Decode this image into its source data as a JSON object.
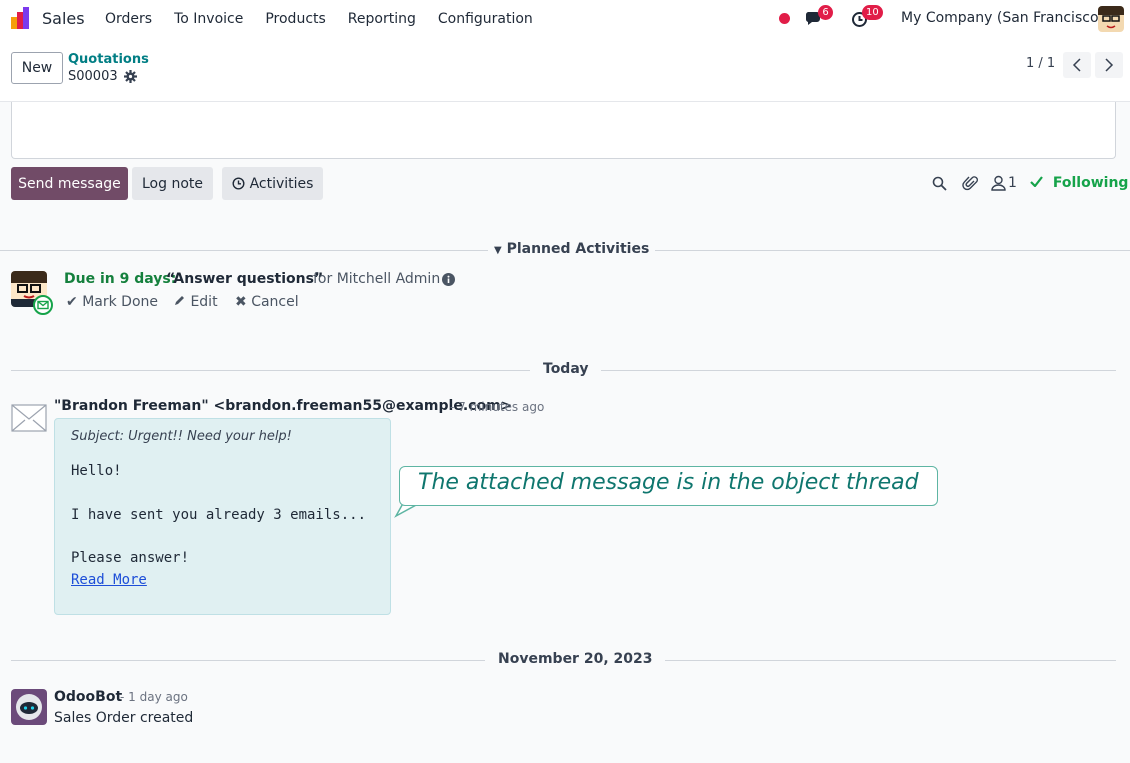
{
  "navbar": {
    "app_name": "Sales",
    "menu": [
      "Orders",
      "To Invoice",
      "Products",
      "Reporting",
      "Configuration"
    ],
    "messages_count": "6",
    "activities_count": "10",
    "company": "My Company (San Francisco)"
  },
  "control": {
    "new_label": "New",
    "breadcrumb_parent": "Quotations",
    "breadcrumb_current": "S00003",
    "pager": "1 / 1"
  },
  "chatter": {
    "send_message": "Send message",
    "log_note": "Log note",
    "activities": "Activities",
    "followers_count": "1",
    "following": "Following"
  },
  "planned": {
    "label": "Planned Activities",
    "due": "Due in 9 days:",
    "title": "“Answer questions”",
    "for": "for Mitchell Admin",
    "mark_done": "Mark Done",
    "edit": "Edit",
    "cancel": "Cancel"
  },
  "today_label": "Today",
  "message": {
    "author": "\"Brandon Freeman\" <brandon.freeman55@example.com>",
    "time": "- 7 minutes ago",
    "subject": "Subject: Urgent!! Need your help!",
    "line1": "Hello!",
    "line2": "I have sent you already 3 emails...",
    "line3": "Please answer!",
    "read_more": "Read More"
  },
  "callout": "The attached message is in the object thread",
  "date_label": "November 20, 2023",
  "bot": {
    "name": "OdooBot",
    "time": "- 1 day ago",
    "body": "Sales Order created"
  },
  "colors": {
    "primary": "#714b67",
    "teal": "#017e84",
    "success": "#16a34a",
    "danger": "#e11d48"
  }
}
